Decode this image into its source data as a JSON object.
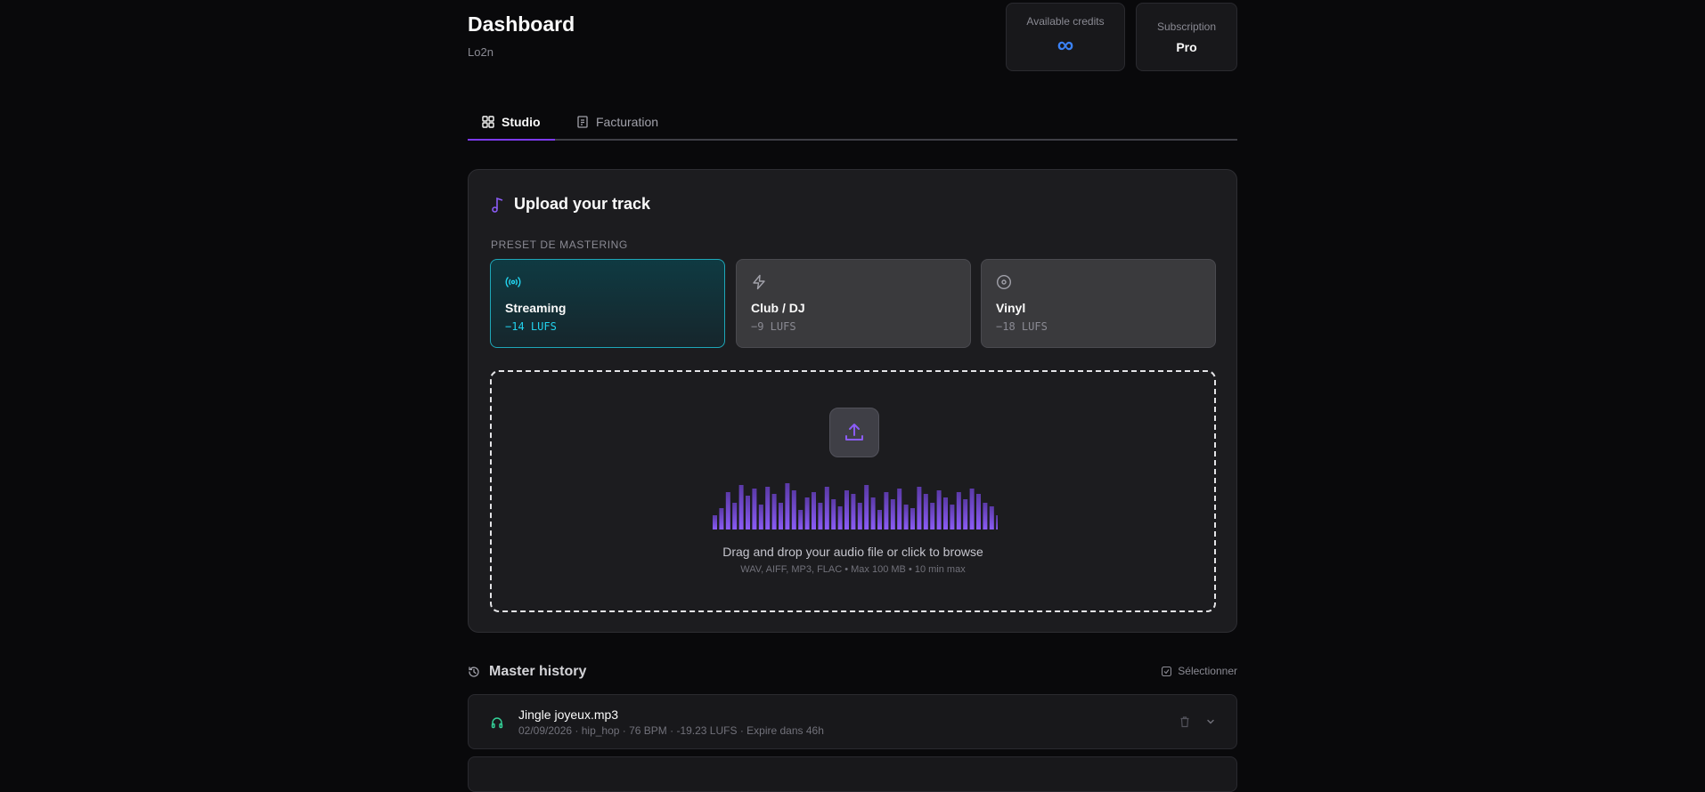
{
  "header": {
    "title": "Dashboard",
    "user": "Lo2n",
    "credits_label": "Available credits",
    "credits_value": "∞",
    "subscription_label": "Subscription",
    "subscription_value": "Pro"
  },
  "tabs": [
    {
      "label": "Studio",
      "active": true,
      "icon": "grid-icon"
    },
    {
      "label": "Facturation",
      "active": false,
      "icon": "receipt-icon"
    }
  ],
  "upload": {
    "title": "Upload your track",
    "preset_label": "PRESET DE MASTERING",
    "presets": [
      {
        "name": "Streaming",
        "lufs": "−14 LUFS",
        "icon": "broadcast-icon",
        "selected": true
      },
      {
        "name": "Club / DJ",
        "lufs": "−9 LUFS",
        "icon": "lightning-icon",
        "selected": false
      },
      {
        "name": "Vinyl",
        "lufs": "−18 LUFS",
        "icon": "disc-icon",
        "selected": false
      }
    ],
    "dropzone_text": "Drag and drop your audio file or click to browse",
    "dropzone_hint": "WAV, AIFF, MP3, FLAC • Max 100 MB • 10 min max"
  },
  "history": {
    "title": "Master history",
    "select_label": "Sélectionner",
    "items": [
      {
        "name": "Jingle joyeux.mp3",
        "meta": "02/09/2026 · hip_hop · 76 BPM · -19.23 LUFS · Expire dans 46h"
      }
    ]
  },
  "colors": {
    "accent": "#7c3aed",
    "streaming": "#22d3ee",
    "infinity": "#3b82f6",
    "history_icon": "#34d399"
  }
}
